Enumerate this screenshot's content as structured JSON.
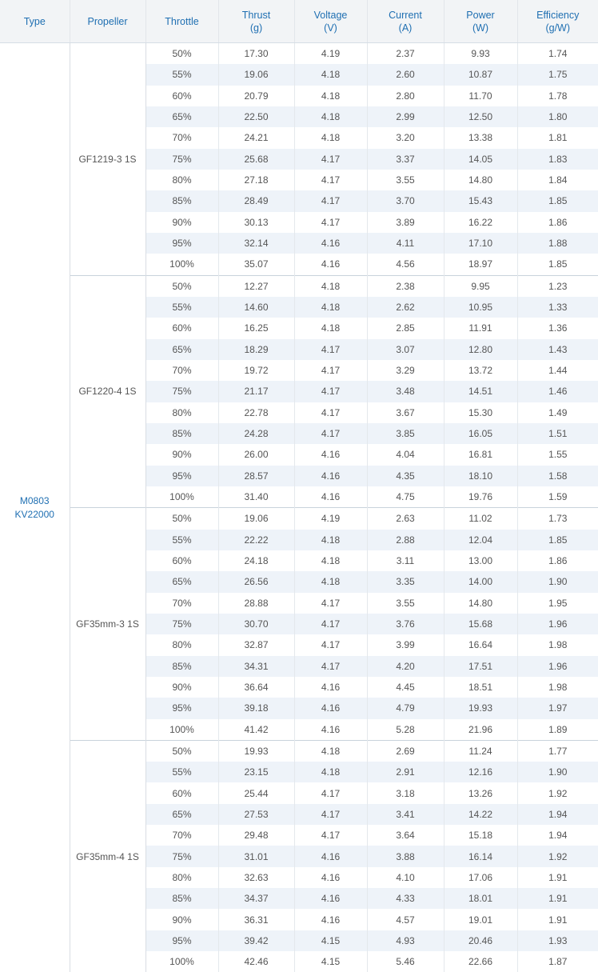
{
  "header": {
    "type": "Type",
    "propeller": "Propeller",
    "throttle": "Throttle",
    "thrust": [
      "Thrust",
      "(g)"
    ],
    "voltage": [
      "Voltage",
      "(V)"
    ],
    "current": [
      "Current",
      "(A)"
    ],
    "power": [
      "Power",
      "(W)"
    ],
    "efficiency": [
      "Efficiency",
      "(g/W)"
    ]
  },
  "motor": {
    "model": "M0803",
    "kv": "KV22000"
  },
  "groups": [
    {
      "propeller": "GF1219-3 1S",
      "rows": [
        [
          "50%",
          "17.30",
          "4.19",
          "2.37",
          "9.93",
          "1.74"
        ],
        [
          "55%",
          "19.06",
          "4.18",
          "2.60",
          "10.87",
          "1.75"
        ],
        [
          "60%",
          "20.79",
          "4.18",
          "2.80",
          "11.70",
          "1.78"
        ],
        [
          "65%",
          "22.50",
          "4.18",
          "2.99",
          "12.50",
          "1.80"
        ],
        [
          "70%",
          "24.21",
          "4.18",
          "3.20",
          "13.38",
          "1.81"
        ],
        [
          "75%",
          "25.68",
          "4.17",
          "3.37",
          "14.05",
          "1.83"
        ],
        [
          "80%",
          "27.18",
          "4.17",
          "3.55",
          "14.80",
          "1.84"
        ],
        [
          "85%",
          "28.49",
          "4.17",
          "3.70",
          "15.43",
          "1.85"
        ],
        [
          "90%",
          "30.13",
          "4.17",
          "3.89",
          "16.22",
          "1.86"
        ],
        [
          "95%",
          "32.14",
          "4.16",
          "4.11",
          "17.10",
          "1.88"
        ],
        [
          "100%",
          "35.07",
          "4.16",
          "4.56",
          "18.97",
          "1.85"
        ]
      ]
    },
    {
      "propeller": "GF1220-4 1S",
      "rows": [
        [
          "50%",
          "12.27",
          "4.18",
          "2.38",
          "9.95",
          "1.23"
        ],
        [
          "55%",
          "14.60",
          "4.18",
          "2.62",
          "10.95",
          "1.33"
        ],
        [
          "60%",
          "16.25",
          "4.18",
          "2.85",
          "11.91",
          "1.36"
        ],
        [
          "65%",
          "18.29",
          "4.17",
          "3.07",
          "12.80",
          "1.43"
        ],
        [
          "70%",
          "19.72",
          "4.17",
          "3.29",
          "13.72",
          "1.44"
        ],
        [
          "75%",
          "21.17",
          "4.17",
          "3.48",
          "14.51",
          "1.46"
        ],
        [
          "80%",
          "22.78",
          "4.17",
          "3.67",
          "15.30",
          "1.49"
        ],
        [
          "85%",
          "24.28",
          "4.17",
          "3.85",
          "16.05",
          "1.51"
        ],
        [
          "90%",
          "26.00",
          "4.16",
          "4.04",
          "16.81",
          "1.55"
        ],
        [
          "95%",
          "28.57",
          "4.16",
          "4.35",
          "18.10",
          "1.58"
        ],
        [
          "100%",
          "31.40",
          "4.16",
          "4.75",
          "19.76",
          "1.59"
        ]
      ]
    },
    {
      "propeller": "GF35mm-3 1S",
      "rows": [
        [
          "50%",
          "19.06",
          "4.19",
          "2.63",
          "11.02",
          "1.73"
        ],
        [
          "55%",
          "22.22",
          "4.18",
          "2.88",
          "12.04",
          "1.85"
        ],
        [
          "60%",
          "24.18",
          "4.18",
          "3.11",
          "13.00",
          "1.86"
        ],
        [
          "65%",
          "26.56",
          "4.18",
          "3.35",
          "14.00",
          "1.90"
        ],
        [
          "70%",
          "28.88",
          "4.17",
          "3.55",
          "14.80",
          "1.95"
        ],
        [
          "75%",
          "30.70",
          "4.17",
          "3.76",
          "15.68",
          "1.96"
        ],
        [
          "80%",
          "32.87",
          "4.17",
          "3.99",
          "16.64",
          "1.98"
        ],
        [
          "85%",
          "34.31",
          "4.17",
          "4.20",
          "17.51",
          "1.96"
        ],
        [
          "90%",
          "36.64",
          "4.16",
          "4.45",
          "18.51",
          "1.98"
        ],
        [
          "95%",
          "39.18",
          "4.16",
          "4.79",
          "19.93",
          "1.97"
        ],
        [
          "100%",
          "41.42",
          "4.16",
          "5.28",
          "21.96",
          "1.89"
        ]
      ]
    },
    {
      "propeller": "GF35mm-4 1S",
      "rows": [
        [
          "50%",
          "19.93",
          "4.18",
          "2.69",
          "11.24",
          "1.77"
        ],
        [
          "55%",
          "23.15",
          "4.18",
          "2.91",
          "12.16",
          "1.90"
        ],
        [
          "60%",
          "25.44",
          "4.17",
          "3.18",
          "13.26",
          "1.92"
        ],
        [
          "65%",
          "27.53",
          "4.17",
          "3.41",
          "14.22",
          "1.94"
        ],
        [
          "70%",
          "29.48",
          "4.17",
          "3.64",
          "15.18",
          "1.94"
        ],
        [
          "75%",
          "31.01",
          "4.16",
          "3.88",
          "16.14",
          "1.92"
        ],
        [
          "80%",
          "32.63",
          "4.16",
          "4.10",
          "17.06",
          "1.91"
        ],
        [
          "85%",
          "34.37",
          "4.16",
          "4.33",
          "18.01",
          "1.91"
        ],
        [
          "90%",
          "36.31",
          "4.16",
          "4.57",
          "19.01",
          "1.91"
        ],
        [
          "95%",
          "39.42",
          "4.15",
          "4.93",
          "20.46",
          "1.93"
        ],
        [
          "100%",
          "42.46",
          "4.15",
          "5.46",
          "22.66",
          "1.87"
        ]
      ]
    }
  ],
  "colors": {
    "header_bg": "#f2f4f6",
    "header_text": "#1f6fb2",
    "stripe": "#eef3f9",
    "type_text": "#1f6fb2"
  }
}
